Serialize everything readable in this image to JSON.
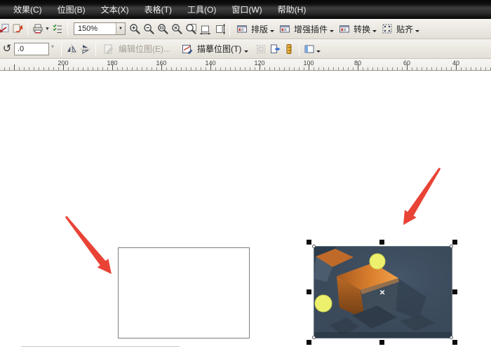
{
  "menu_bar": {
    "items": [
      "效果(C)",
      "位图(B)",
      "文本(X)",
      "表格(T)",
      "工具(O)",
      "窗口(W)",
      "帮助(H)"
    ]
  },
  "standard_toolbar": {
    "zoom_combo": {
      "value": "150%"
    },
    "flyouts": [
      {
        "label": "排版"
      },
      {
        "label": "增强插件"
      },
      {
        "label": "转换"
      },
      {
        "label": "贴齐"
      }
    ]
  },
  "property_bar": {
    "rotation_value": ".0",
    "degree": "°",
    "edit_bitmap_label": "编辑位图(E)...",
    "trace_bitmap_label": "描摹位图(T)"
  },
  "ruler": {
    "unit_labels": [
      "200",
      "180",
      "160",
      "140",
      "120",
      "100",
      "80",
      "60",
      "40"
    ]
  },
  "canvas": {
    "selection_center_marker": "×",
    "colors": {
      "annotation_arrow": "#e8392b",
      "bitmap_background": "#3b4a5a",
      "cube_orange": "#e8923f",
      "ball_yellow": "#edf06c"
    }
  },
  "glyphs": {
    "rotate_ccw": "↺",
    "dropdown": "▼"
  }
}
